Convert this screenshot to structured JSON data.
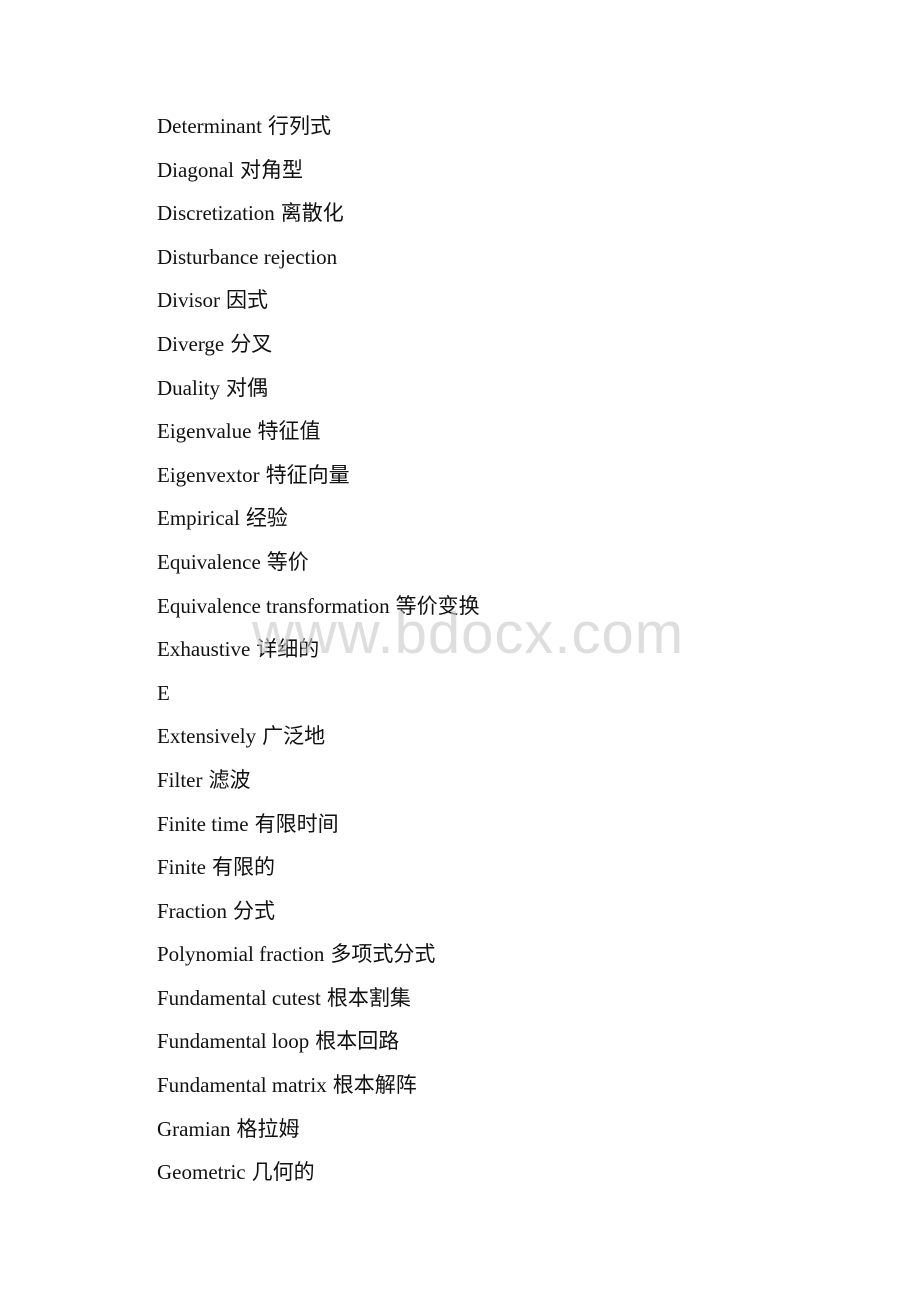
{
  "document": {
    "watermark": "www.bdocx.com",
    "terms": [
      {
        "en": "Determinant",
        "zh": "行列式"
      },
      {
        "en": "Diagonal",
        "zh": "对角型"
      },
      {
        "en": "Discretization",
        "zh": "离散化"
      },
      {
        "en": "Disturbance rejection",
        "zh": ""
      },
      {
        "en": "Divisor",
        "zh": "因式"
      },
      {
        "en": "Diverge",
        "zh": "分叉"
      },
      {
        "en": "Duality",
        "zh": "对偶"
      },
      {
        "en": "Eigenvalue",
        "zh": "特征值"
      },
      {
        "en": "Eigenvextor",
        "zh": "特征向量"
      },
      {
        "en": "Empirical",
        "zh": "经验"
      },
      {
        "en": "Equivalence",
        "zh": "等价"
      },
      {
        "en": "Equivalence transformation",
        "zh": "等价变换"
      },
      {
        "en": "Exhaustive",
        "zh": "详细的"
      },
      {
        "en": "E",
        "zh": ""
      },
      {
        "en": "Extensively",
        "zh": "广泛地"
      },
      {
        "en": "Filter",
        "zh": "滤波"
      },
      {
        "en": "Finite time",
        "zh": "有限时间"
      },
      {
        "en": "Finite",
        "zh": "有限的"
      },
      {
        "en": "Fraction",
        "zh": "分式"
      },
      {
        "en": "Polynomial fraction",
        "zh": "多项式分式"
      },
      {
        "en": "Fundamental cutest",
        "zh": "根本割集"
      },
      {
        "en": "Fundamental loop",
        "zh": "根本回路"
      },
      {
        "en": "Fundamental matrix",
        "zh": "根本解阵"
      },
      {
        "en": "Gramian",
        "zh": "格拉姆"
      },
      {
        "en": "Geometric",
        "zh": "几何的"
      }
    ]
  }
}
